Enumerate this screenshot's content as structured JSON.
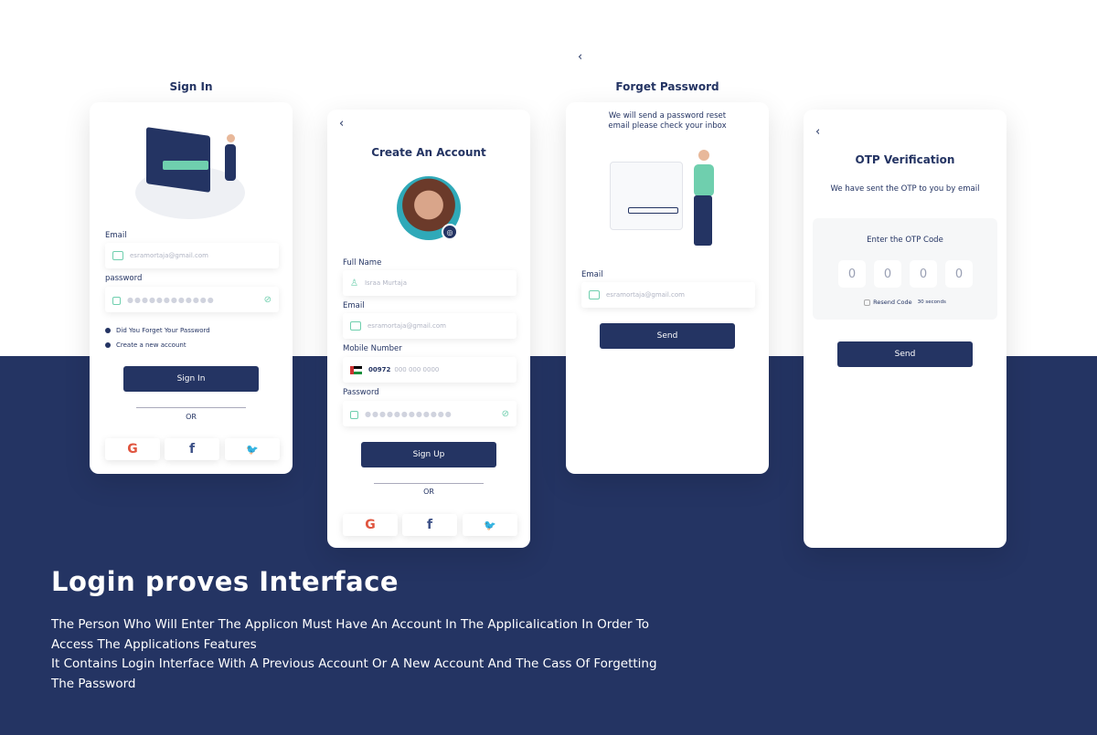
{
  "colors": {
    "primary": "#243463",
    "accent": "#6fcfae",
    "background": "#ffffff"
  },
  "signin": {
    "title": "Sign In",
    "email_label": "Email",
    "email_value": "esramortaja@gmail.com",
    "password_label": "password",
    "password_value": "●●●●●●●●●●●●",
    "forgot_link": "Did You Forget Your Password",
    "create_link": "Create a new account",
    "button": "Sign In",
    "or": "OR"
  },
  "signup": {
    "title": "Create An Account",
    "fullname_label": "Full Name",
    "fullname_value": "Israa Murtaja",
    "email_label": "Email",
    "email_value": "esramortaja@gmail.com",
    "mobile_label": "Mobile Number",
    "mobile_code": "00972",
    "mobile_placeholder": "000 000 0000",
    "password_label": "Password",
    "password_value": "●●●●●●●●●●●●",
    "button": "Sign Up",
    "or": "OR"
  },
  "forget": {
    "title": "Forget Password",
    "subtitle_line1": "We will send a password reset",
    "subtitle_line2": "email please check your inbox",
    "email_label": "Email",
    "email_value": "esramortaja@gmail.com",
    "button": "Send"
  },
  "otp": {
    "title": "OTP Verification",
    "subtitle": "We have sent the OTP to you by email",
    "prompt": "Enter the OTP Code",
    "digits": [
      "0",
      "0",
      "0",
      "0"
    ],
    "resend": "Resend Code",
    "timer": "30 seconds",
    "button": "Send"
  },
  "social": {
    "google": "G",
    "facebook": "f",
    "twitter": "🐦"
  },
  "footer": {
    "heading": "Login proves Interface",
    "line1": "The Person Who Will Enter The Applicon Must Have An Account In The Applicalication In Order To Access The Applications Features",
    "line2": "It Contains Login Interface With A Previous Account Or A New Account And The Cass Of Forgetting The Password"
  }
}
